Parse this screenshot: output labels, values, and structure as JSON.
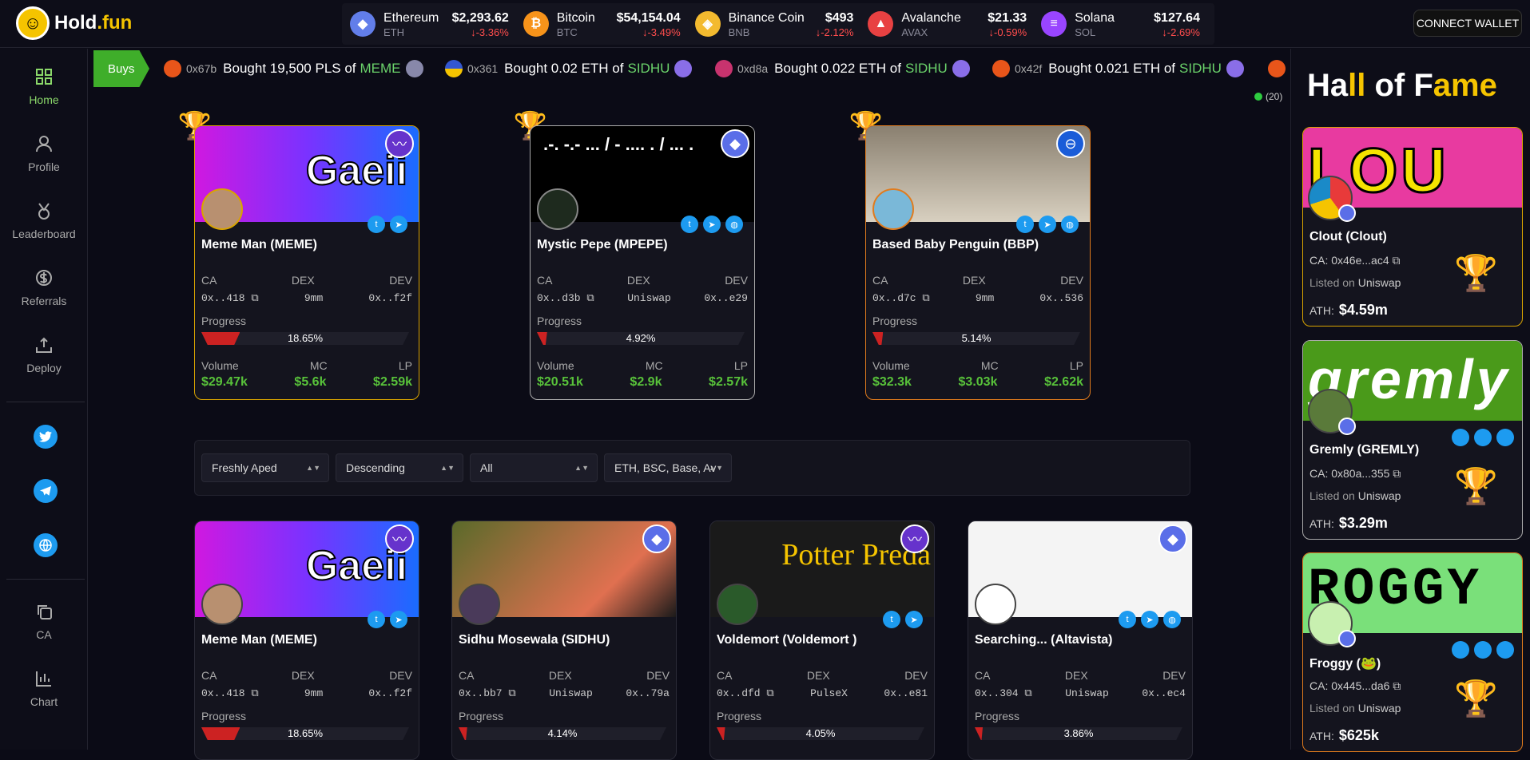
{
  "app": {
    "logo_main": "Hold",
    "logo_suffix": ".fun"
  },
  "tickers": [
    {
      "name": "Ethereum",
      "symbol": "ETH",
      "price": "$2,293.62",
      "change": "↓-3.36%",
      "color": "#627eea",
      "glyph": "◆"
    },
    {
      "name": "Bitcoin",
      "symbol": "BTC",
      "price": "$54,154.04",
      "change": "↓-3.49%",
      "color": "#f7931a",
      "glyph": "₿"
    },
    {
      "name": "Binance Coin",
      "symbol": "BNB",
      "price": "$493",
      "change": "↓-2.12%",
      "color": "#f3ba2f",
      "glyph": "◈"
    },
    {
      "name": "Avalanche",
      "symbol": "AVAX",
      "price": "$21.33",
      "change": "↓-0.59%",
      "color": "#e84142",
      "glyph": "▲"
    },
    {
      "name": "Solana",
      "symbol": "SOL",
      "price": "$127.64",
      "change": "↓-2.69%",
      "color": "#9945ff",
      "glyph": "≡"
    }
  ],
  "connect_label": "CONNECT WALLET",
  "nav": [
    {
      "label": "Home",
      "icon": "grid-icon"
    },
    {
      "label": "Profile",
      "icon": "user-icon"
    },
    {
      "label": "Leaderboard",
      "icon": "medal-icon"
    },
    {
      "label": "Referrals",
      "icon": "dollar-icon"
    },
    {
      "label": "Deploy",
      "icon": "upload-icon"
    },
    {
      "label": "CA",
      "icon": "copy-icon"
    },
    {
      "label": "Chart",
      "icon": "chart-icon"
    }
  ],
  "buys": {
    "tag": "Buys",
    "items": [
      {
        "addr": "0x67b",
        "text": "Bought 19,500 PLS of",
        "token": "MEME"
      },
      {
        "addr": "0x361",
        "text": "Bought 0.02 ETH of",
        "token": "SIDHU"
      },
      {
        "addr": "0xd8a",
        "text": "Bought 0.022 ETH of",
        "token": "SIDHU"
      },
      {
        "addr": "0x42f",
        "text": "Bought 0.021 ETH of",
        "token": "SIDHU"
      }
    ]
  },
  "online": "(20)",
  "top_cards": [
    {
      "rank": "1",
      "title": "Meme Man (MEME)",
      "banner": "Gaeii",
      "ca": "0x..418",
      "dex": "9mm",
      "dev": "0x..f2f",
      "progress_label": "18.65%",
      "progress": 0.1865,
      "volume": "$29.47k",
      "mc": "$5.6k",
      "lp": "$2.59k"
    },
    {
      "rank": "2",
      "title": "Mystic Pepe (MPEPE)",
      "banner": ".-. -.- ... / - .... . / ... .",
      "ca": "0x..d3b",
      "dex": "Uniswap",
      "dev": "0x..e29",
      "progress_label": "4.92%",
      "progress": 0.0492,
      "volume": "$20.51k",
      "mc": "$2.9k",
      "lp": "$2.57k"
    },
    {
      "rank": "3",
      "title": "Based Baby Penguin (BBP)",
      "banner": "",
      "ca": "0x..d7c",
      "dex": "9mm",
      "dev": "0x..536",
      "progress_label": "5.14%",
      "progress": 0.0514,
      "volume": "$32.3k",
      "mc": "$3.03k",
      "lp": "$2.62k"
    }
  ],
  "labels": {
    "ca": "CA",
    "dex": "DEX",
    "dev": "DEV",
    "progress": "Progress",
    "volume": "Volume",
    "mc": "MC",
    "lp": "LP"
  },
  "filters": [
    {
      "value": "Freshly Aped"
    },
    {
      "value": "Descending"
    },
    {
      "value": "All"
    },
    {
      "value": "ETH, BSC, Base, Av"
    }
  ],
  "list_cards": [
    {
      "title": "Meme Man (MEME)",
      "banner": "Gaeii",
      "ca": "0x..418",
      "dex": "9mm",
      "dev": "0x..f2f",
      "progress_label": "18.65%",
      "progress": 0.1865
    },
    {
      "title": "Sidhu Mosewala (SIDHU)",
      "banner": "",
      "ca": "0x..bb7",
      "dex": "Uniswap",
      "dev": "0x..79a",
      "progress_label": "4.14%",
      "progress": 0.0414
    },
    {
      "title": "Voldemort (Voldemort )",
      "banner": "Potter Preda",
      "ca": "0x..dfd",
      "dex": "PulseX",
      "dev": "0x..e81",
      "progress_label": "4.05%",
      "progress": 0.0405
    },
    {
      "title": "Searching... (Altavista)",
      "banner": "",
      "ca": "0x..304",
      "dex": "Uniswap",
      "dev": "0x..ec4",
      "progress_label": "3.86%",
      "progress": 0.0386
    }
  ],
  "hof": {
    "title_a": "Ha",
    "title_b": "ll",
    "title_c": " of F",
    "title_d": "ame",
    "items": [
      {
        "rank": "1",
        "name": "Clout (Clout)",
        "banner": "LOU",
        "ca": "CA: 0x46e...ac4",
        "listed": "Listed on",
        "dex": "Uniswap",
        "ath_label": "ATH:",
        "ath": "$4.59m"
      },
      {
        "rank": "2",
        "name": "Gremly (GREMLY)",
        "banner": "gremly",
        "ca": "CA: 0x80a...355",
        "listed": "Listed on",
        "dex": "Uniswap",
        "ath_label": "ATH:",
        "ath": "$3.29m"
      },
      {
        "rank": "3",
        "name": "Froggy (🐸)",
        "banner": "ROGGY",
        "ca": "CA: 0x445...da6",
        "listed": "Listed on",
        "dex": "Uniswap",
        "ath_label": "ATH:",
        "ath": "$625k"
      }
    ]
  }
}
